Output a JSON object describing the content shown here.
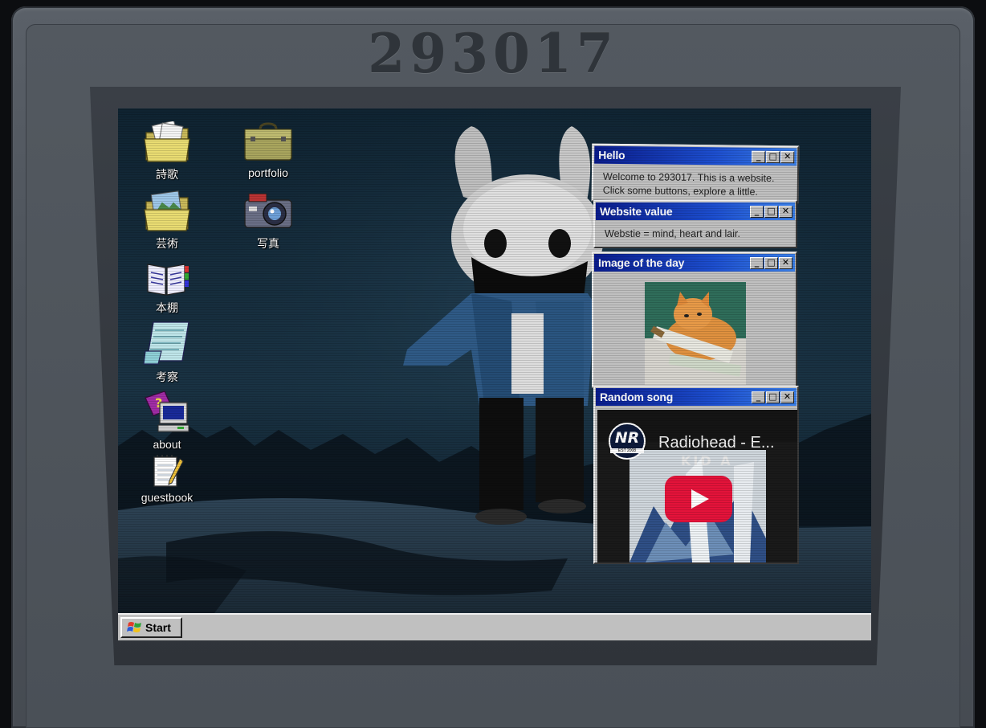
{
  "brand": "293017",
  "desktop_icons": [
    {
      "label": "詩歌",
      "icon": "documents-folder-icon"
    },
    {
      "label": "portfolio",
      "icon": "briefcase-icon"
    },
    {
      "label": "芸術",
      "icon": "pictures-folder-icon"
    },
    {
      "label": "写真",
      "icon": "camera-icon"
    },
    {
      "label": "本棚",
      "icon": "book-icon"
    },
    {
      "label": "考察",
      "icon": "notepad-icon"
    },
    {
      "label": "about",
      "icon": "help-computer-icon"
    },
    {
      "label": "guestbook",
      "icon": "notebook-pencil-icon"
    }
  ],
  "windows": {
    "hello": {
      "title": "Hello",
      "line1": "Welcome to 293017. This is a website.",
      "line2": "Click some buttons, explore a little."
    },
    "value": {
      "title": "Website value",
      "text": "Webstie = mind, heart and lair."
    },
    "image": {
      "title": "Image of the day"
    },
    "song": {
      "title": "Random song",
      "channel": "NR",
      "channel_sub": "EST 2008",
      "video_title": "Radiohead - E...",
      "album_text": "KID A"
    },
    "controls": {
      "minimize": "_",
      "maximize": "□",
      "close": "✕"
    }
  },
  "taskbar": {
    "start_label": "Start"
  },
  "colors": {
    "titlebar_start": "#0a1c8c",
    "titlebar_end": "#3a7fe8",
    "window_face": "#c0c0c0",
    "youtube_red": "#e4133a"
  }
}
